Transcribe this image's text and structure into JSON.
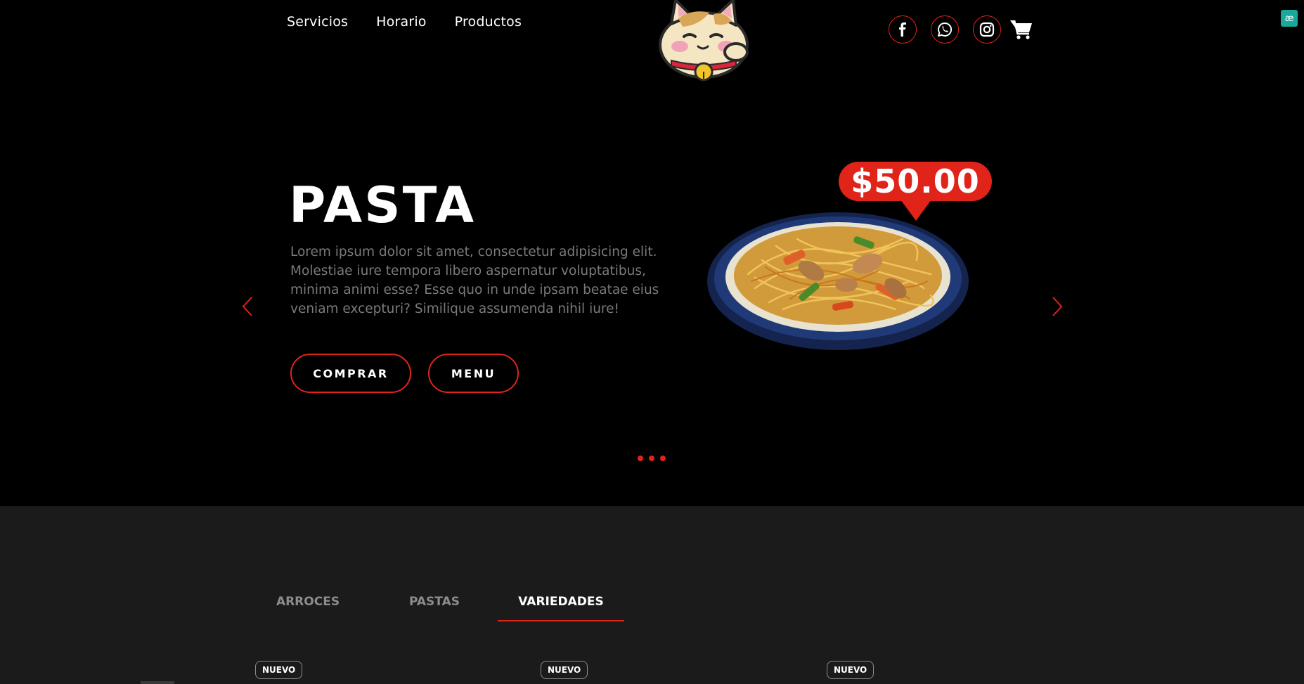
{
  "nav": {
    "items": [
      "Servicios",
      "Horario",
      "Productos"
    ]
  },
  "social": {
    "icons": [
      "facebook-icon",
      "whatsapp-icon",
      "instagram-icon"
    ],
    "cart_icon": "cart-icon"
  },
  "extension": {
    "label": "æ"
  },
  "hero": {
    "title": "PASTA",
    "description": "Lorem ipsum dolor sit amet, consectetur adipisicing elit. Molestiae iure tempora libero aspernatur voluptatibus, minima animi esse? Esse quo in unde ipsam beatae eius veniam excepturi? Similique assumenda nihil iure!",
    "buy_label": "COMPRAR",
    "menu_label": "MENU",
    "price": "$50.00",
    "slide_count": 3
  },
  "menu_section": {
    "tabs": [
      {
        "label": "ARROCES",
        "active": false
      },
      {
        "label": "PASTAS",
        "active": false
      },
      {
        "label": "VARIEDADES",
        "active": true
      }
    ],
    "badges": [
      "NUEVO",
      "NUEVO",
      "NUEVO"
    ]
  },
  "colors": {
    "accent": "#e0241a",
    "background": "#000000",
    "section_background": "#1b1b1b",
    "muted_text": "#7a7a7a"
  }
}
